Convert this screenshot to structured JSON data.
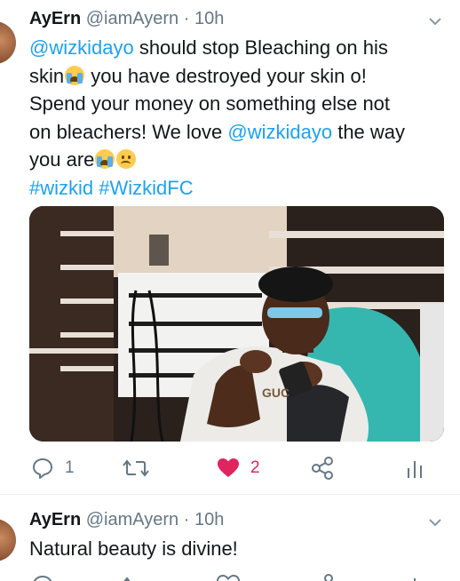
{
  "tweets": [
    {
      "author_name": "AyErn",
      "handle": "@iamAyern",
      "separator": "·",
      "time": "10h",
      "text": {
        "line1_mention": "@wizkidayo",
        "line1_rest": " should stop Bleaching on his",
        "line2_a": "skin",
        "line2_b": " you have destroyed your skin o!",
        "line3": "Spend your money on something else not",
        "line4_a": "on bleachers! We love ",
        "line4_mention": "@wizkidayo",
        "line4_b": " the way",
        "line5": "you are",
        "hashtag1": "#wizkid",
        "hashtag2": "#WizkidFC"
      },
      "emojis": [
        "loudly-crying-face",
        "loudly-crying-face",
        "frowning-face"
      ],
      "media": {
        "kind": "photo",
        "sweater_text": "GUC"
      },
      "actions": {
        "reply_count": "1",
        "retweet_count": "",
        "like_count": "2",
        "liked": true
      }
    },
    {
      "author_name": "AyErn",
      "handle": "@iamAyern",
      "separator": "·",
      "time": "10h",
      "text": {
        "line1": "Natural beauty is divine!"
      }
    }
  ],
  "colors": {
    "link": "#1da1f2",
    "secondary": "#657786",
    "primary_text": "#14171a",
    "like": "#e0245e"
  }
}
